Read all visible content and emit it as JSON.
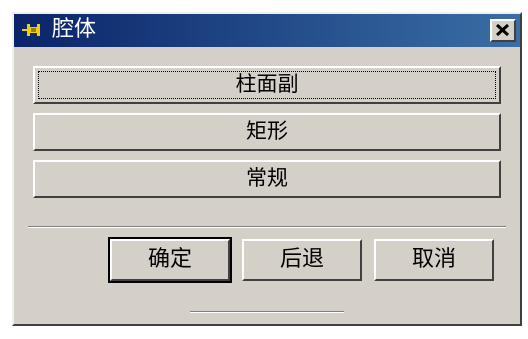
{
  "window": {
    "title": "腔体",
    "icon": "pin-icon",
    "close_icon": "close-icon"
  },
  "options": [
    {
      "label": "柱面副"
    },
    {
      "label": "矩形"
    },
    {
      "label": "常规"
    }
  ],
  "actions": {
    "ok_label": "确定",
    "back_label": "后退",
    "cancel_label": "取消"
  },
  "colors": {
    "titlebar_start": "#0a246a",
    "titlebar_end": "#3a6ea5",
    "face": "#d4d0c8"
  }
}
